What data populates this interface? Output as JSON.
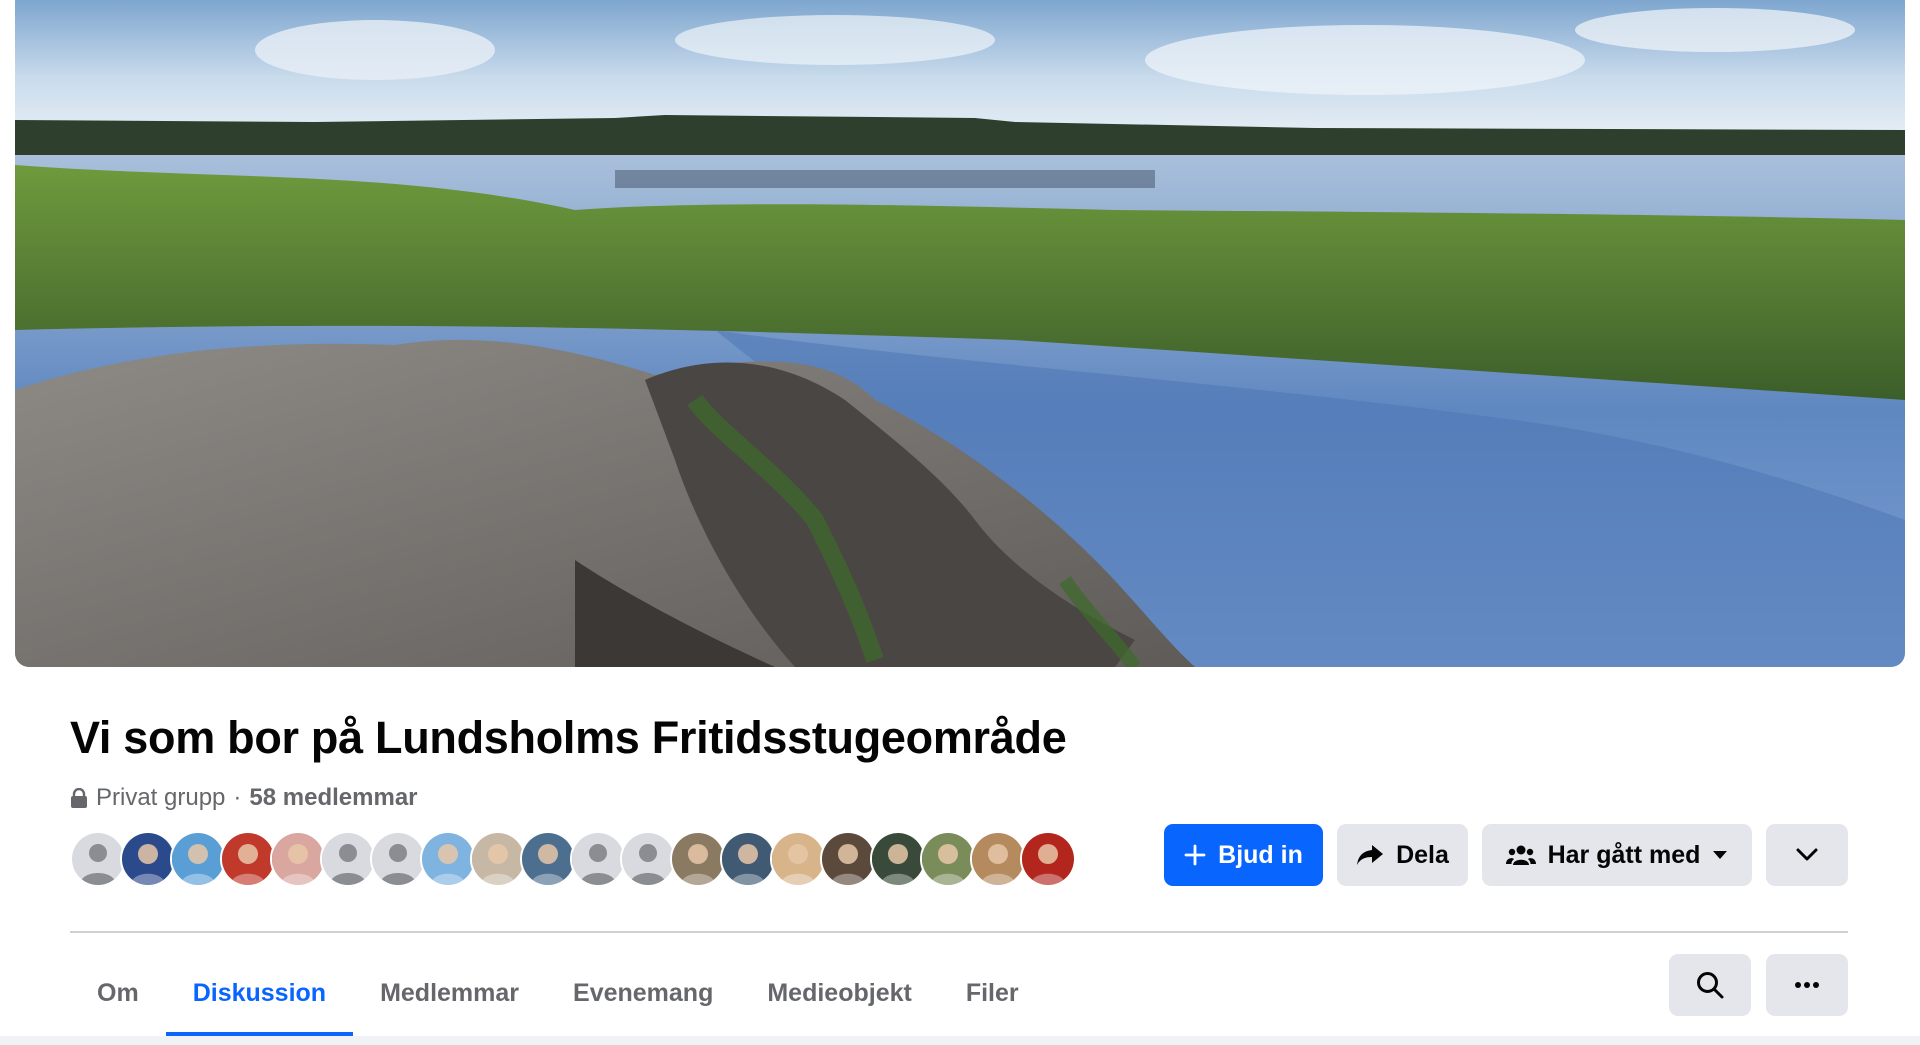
{
  "group": {
    "title": "Vi som bor på Lundsholms Fritidsstugeområde",
    "privacy": "Privat grupp",
    "separator": "·",
    "members": "58 medlemmar"
  },
  "cover_photo": {
    "icon": "lake-landscape-photo"
  },
  "member_avatars": [
    {
      "kind": "default"
    },
    {
      "kind": "photo",
      "color": "#2b4a8c"
    },
    {
      "kind": "photo",
      "color": "#5a9ed6"
    },
    {
      "kind": "photo",
      "color": "#c0392b"
    },
    {
      "kind": "photo",
      "color": "#d9a6a0"
    },
    {
      "kind": "default"
    },
    {
      "kind": "default"
    },
    {
      "kind": "photo",
      "color": "#7fb3e0"
    },
    {
      "kind": "photo",
      "color": "#c7b8a6"
    },
    {
      "kind": "photo",
      "color": "#4d6f8f"
    },
    {
      "kind": "default"
    },
    {
      "kind": "default"
    },
    {
      "kind": "photo",
      "color": "#8a7a62"
    },
    {
      "kind": "photo",
      "color": "#3f5a72"
    },
    {
      "kind": "photo",
      "color": "#d8b48a"
    },
    {
      "kind": "photo",
      "color": "#5b4a3c"
    },
    {
      "kind": "photo",
      "color": "#3a4a3a"
    },
    {
      "kind": "photo",
      "color": "#7a8c5a"
    },
    {
      "kind": "photo",
      "color": "#b48a5e"
    },
    {
      "kind": "photo",
      "color": "#b3261e"
    }
  ],
  "actions": {
    "invite_label": "Bjud in",
    "share_label": "Dela",
    "joined_label": "Har gått med"
  },
  "tabs": [
    {
      "label": "Om",
      "active": false
    },
    {
      "label": "Diskussion",
      "active": true
    },
    {
      "label": "Medlemmar",
      "active": false
    },
    {
      "label": "Evenemang",
      "active": false
    },
    {
      "label": "Medieobjekt",
      "active": false
    },
    {
      "label": "Filer",
      "active": false
    }
  ],
  "colors": {
    "accent": "#0866ff",
    "secondary_button": "#e4e6eb",
    "muted_text": "#65676b"
  }
}
